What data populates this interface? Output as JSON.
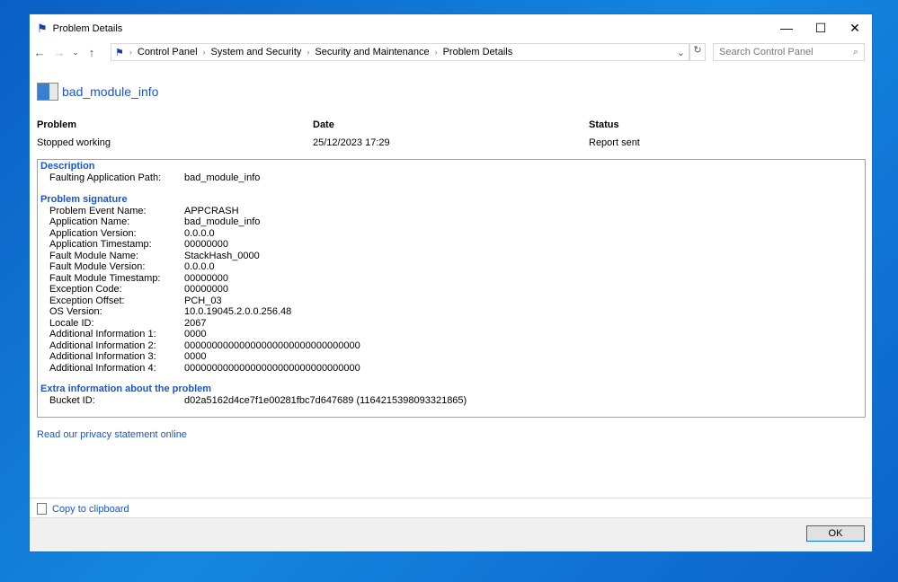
{
  "window": {
    "title": "Problem Details"
  },
  "nav": {
    "breadcrumb": [
      "Control Panel",
      "System and Security",
      "Security and Maintenance",
      "Problem Details"
    ],
    "search_placeholder": "Search Control Panel"
  },
  "app_name": "bad_module_info",
  "summary": {
    "headers": [
      "Problem",
      "Date",
      "Status"
    ],
    "values": [
      "Stopped working",
      "25/12/2023 17:29",
      "Report sent"
    ]
  },
  "description": {
    "title": "Description",
    "rows": [
      {
        "k": "Faulting Application Path:",
        "v": "bad_module_info"
      }
    ]
  },
  "signature": {
    "title": "Problem signature",
    "rows": [
      {
        "k": "Problem Event Name:",
        "v": "APPCRASH"
      },
      {
        "k": "Application Name:",
        "v": "bad_module_info"
      },
      {
        "k": "Application Version:",
        "v": "0.0.0.0"
      },
      {
        "k": "Application Timestamp:",
        "v": "00000000"
      },
      {
        "k": "Fault Module Name:",
        "v": "StackHash_0000"
      },
      {
        "k": "Fault Module Version:",
        "v": "0.0.0.0"
      },
      {
        "k": "Fault Module Timestamp:",
        "v": "00000000"
      },
      {
        "k": "Exception Code:",
        "v": "00000000"
      },
      {
        "k": "Exception Offset:",
        "v": "PCH_03"
      },
      {
        "k": "OS Version:",
        "v": "10.0.19045.2.0.0.256.48"
      },
      {
        "k": "Locale ID:",
        "v": "2067"
      },
      {
        "k": "Additional Information 1:",
        "v": "0000"
      },
      {
        "k": "Additional Information 2:",
        "v": "00000000000000000000000000000000"
      },
      {
        "k": "Additional Information 3:",
        "v": "0000"
      },
      {
        "k": "Additional Information 4:",
        "v": "00000000000000000000000000000000"
      }
    ]
  },
  "extra": {
    "title": "Extra information about the problem",
    "rows": [
      {
        "k": "Bucket ID:",
        "v": "d02a5162d4ce7f1e00281fbc7d647689 (1164215398093321865)"
      }
    ]
  },
  "privacy_link": "Read our privacy statement online",
  "copy_link": "Copy to clipboard",
  "ok_label": "OK"
}
